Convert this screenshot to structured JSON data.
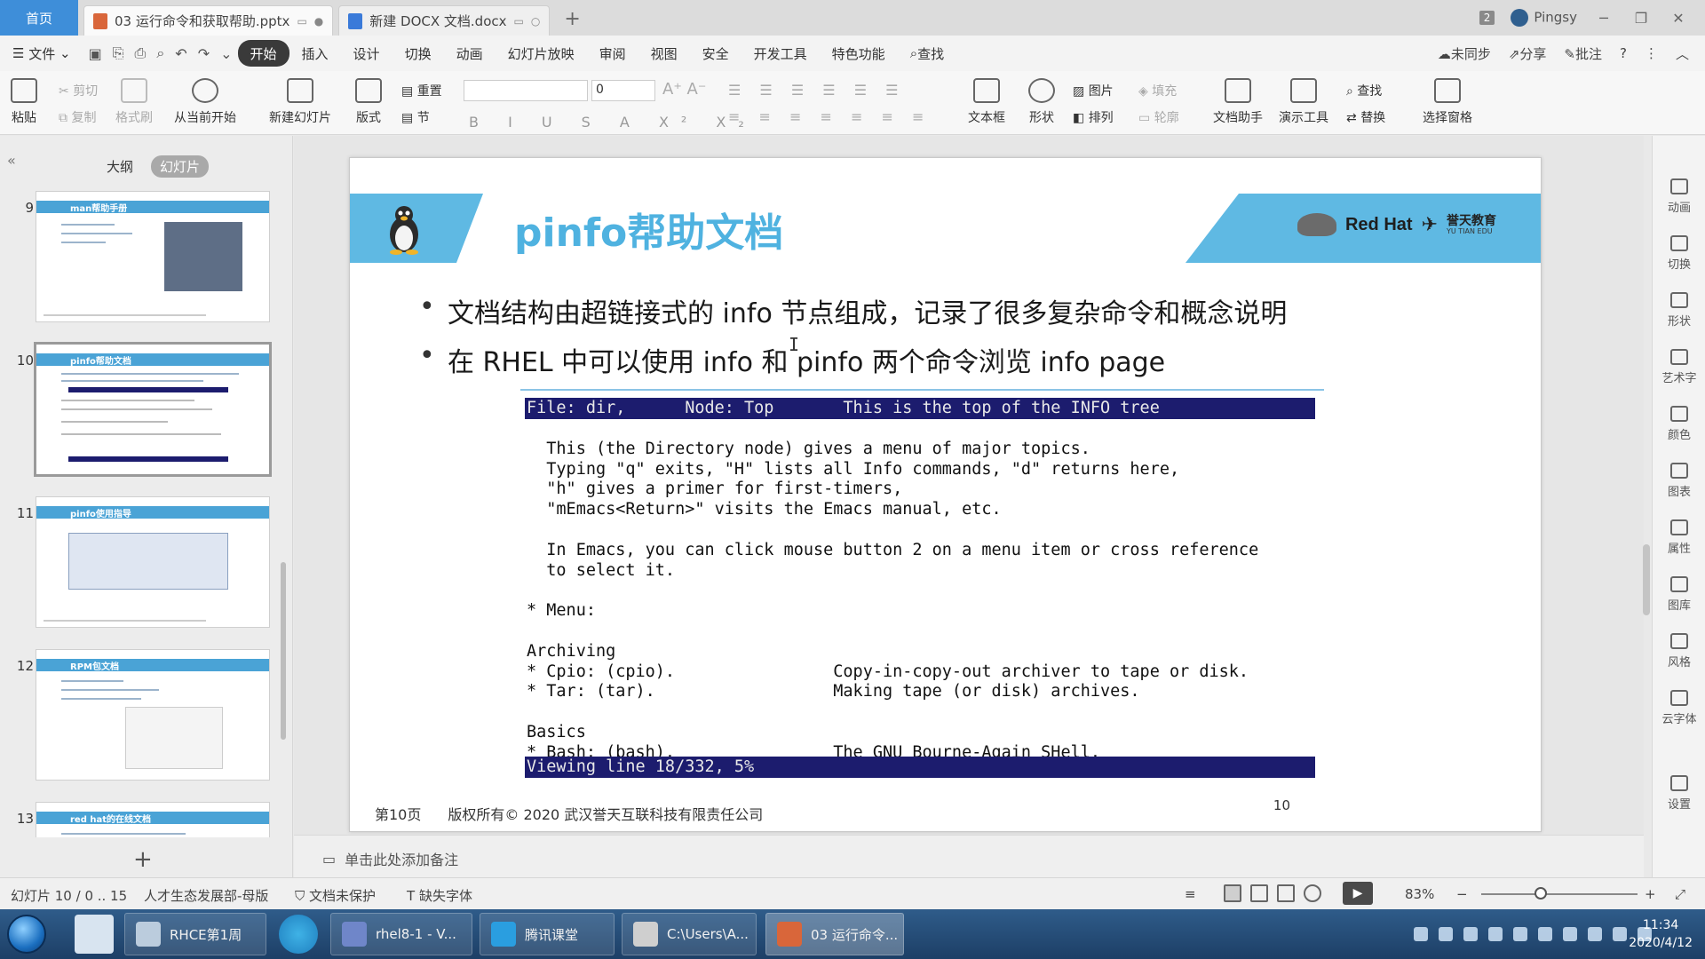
{
  "titlebar": {
    "home_tab": "首页",
    "tabs": [
      {
        "label": "03 运行命令和获取帮助.pptx"
      },
      {
        "label": "新建 DOCX 文档.docx"
      }
    ],
    "window_count": "2",
    "user": "Pingsy"
  },
  "menubar": {
    "file": "文件",
    "items": [
      "开始",
      "插入",
      "设计",
      "切换",
      "动画",
      "幻灯片放映",
      "审阅",
      "视图",
      "安全",
      "开发工具",
      "特色功能"
    ],
    "search": "查找",
    "right": [
      "未同步",
      "分享",
      "批注"
    ]
  },
  "ribbon": {
    "paste": "粘贴",
    "cut": "剪切",
    "copy": "复制",
    "format_painter": "格式刷",
    "from_current": "从当前开始",
    "new_slide": "新建幻灯片",
    "layout": "版式",
    "reset": "重置",
    "section": "节",
    "font_size": "0",
    "textbox": "文本框",
    "shape": "形状",
    "picture": "图片",
    "fill": "填充",
    "arrange": "排列",
    "outline": "轮廓",
    "doc_assistant": "文档助手",
    "presentation_tools": "演示工具",
    "find": "查找",
    "replace": "替换",
    "select_pane": "选择窗格"
  },
  "leftpanel": {
    "outline_tab": "大纲",
    "slides_tab": "幻灯片",
    "thumbs": [
      {
        "num": "9",
        "title": "man帮助手册"
      },
      {
        "num": "10",
        "title": "pinfo帮助文档"
      },
      {
        "num": "11",
        "title": "pinfo使用指导"
      },
      {
        "num": "12",
        "title": "RPM包文档"
      },
      {
        "num": "13",
        "title": "red hat的在线文档"
      }
    ]
  },
  "slide": {
    "title": "pinfo帮助文档",
    "logo_redhat": "Red Hat",
    "logo_yt": "誉天教育",
    "logo_yt_sub": "YU TIAN EDU",
    "bullets": [
      "文档结构由超链接式的 info 节点组成，记录了很多复杂命令和概念说明",
      "在 RHEL 中可以使用 info 和 pinfo 两个命令浏览 info page"
    ],
    "terminal": {
      "header": "File: dir,      Node: Top       This is the top of the INFO tree",
      "lines": [
        "",
        "  This (the Directory node) gives a menu of major topics.",
        "  Typing \"q\" exits, \"H\" lists all Info commands, \"d\" returns here,",
        "  \"h\" gives a primer for first-timers,",
        "  \"mEmacs<Return>\" visits the Emacs manual, etc.",
        "",
        "  In Emacs, you can click mouse button 2 on a menu item or cross reference",
        "  to select it.",
        "",
        "* Menu:",
        "",
        "Archiving",
        "* Cpio: (cpio).                Copy-in-copy-out archiver to tape or disk.",
        "* Tar: (tar).                  Making tape (or disk) archives.",
        "",
        "Basics",
        "* Bash: (bash).                The GNU Bourne-Again SHell."
      ],
      "footer": "Viewing line 18/332, 5%"
    },
    "footer_page": "第10页",
    "footer_copyright": "版权所有© 2020 武汉誉天互联科技有限责任公司",
    "page_number": "10"
  },
  "notes_placeholder": "单击此处添加备注",
  "rightbar": [
    "动画",
    "切换",
    "形状",
    "艺术字",
    "颜色",
    "图表",
    "属性",
    "图库",
    "风格",
    "云字体",
    "设置"
  ],
  "statusbar": {
    "slide_info": "幻灯片 10 / 0 .. 15",
    "theme": "人才生态发展部-母版",
    "protect": "文档未保护",
    "missing_font": "缺失字体",
    "zoom": "83%"
  },
  "taskbar": {
    "apps": [
      "RHCE第1周",
      "rhel8-1 - V...",
      "腾讯课堂",
      "C:\\Users\\A...",
      "03 运行命令..."
    ],
    "time": "11:34",
    "date": "2020/4/12"
  }
}
